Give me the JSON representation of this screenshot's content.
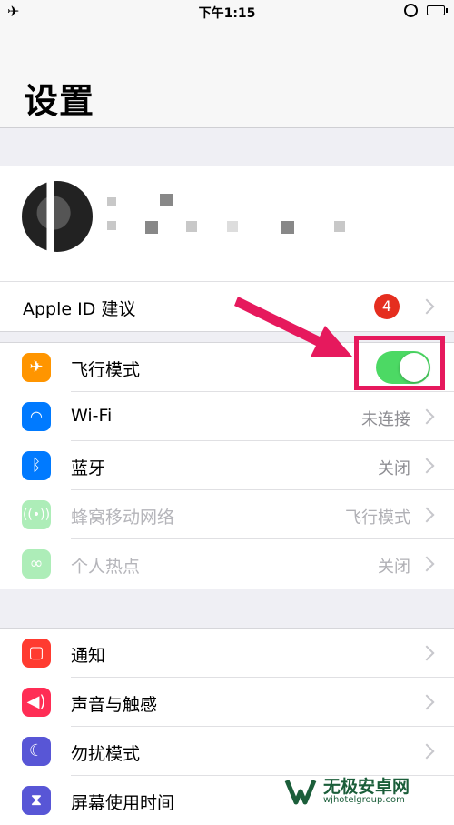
{
  "status_bar": {
    "time": "下午1:15"
  },
  "nav": {
    "title": "设置"
  },
  "account": {
    "apple_id_label": "Apple ID 建议",
    "badge_count": "4"
  },
  "connectivity": [
    {
      "label": "飞行模式",
      "value": "",
      "icon": "airplane-icon",
      "color": "#ff9500",
      "toggle_on": true
    },
    {
      "label": "Wi-Fi",
      "value": "未连接",
      "icon": "wifi-icon",
      "color": "#007aff"
    },
    {
      "label": "蓝牙",
      "value": "关闭",
      "icon": "bluetooth-icon",
      "color": "#007aff"
    },
    {
      "label": "蜂窝移动网络",
      "value": "飞行模式",
      "icon": "cellular-icon",
      "color": "#4cd964",
      "disabled": true
    },
    {
      "label": "个人热点",
      "value": "关闭",
      "icon": "hotspot-icon",
      "color": "#4cd964",
      "disabled": true
    }
  ],
  "system": [
    {
      "label": "通知",
      "icon": "notifications-icon",
      "color": "#ff3b30"
    },
    {
      "label": "声音与触感",
      "icon": "sound-icon",
      "color": "#ff2d55"
    },
    {
      "label": "勿扰模式",
      "icon": "moon-icon",
      "color": "#5856d6"
    },
    {
      "label": "屏幕使用时间",
      "icon": "hourglass-icon",
      "color": "#5856d6"
    }
  ],
  "watermark": {
    "name": "无极安卓网",
    "url": "wjhotelgroup.com"
  }
}
